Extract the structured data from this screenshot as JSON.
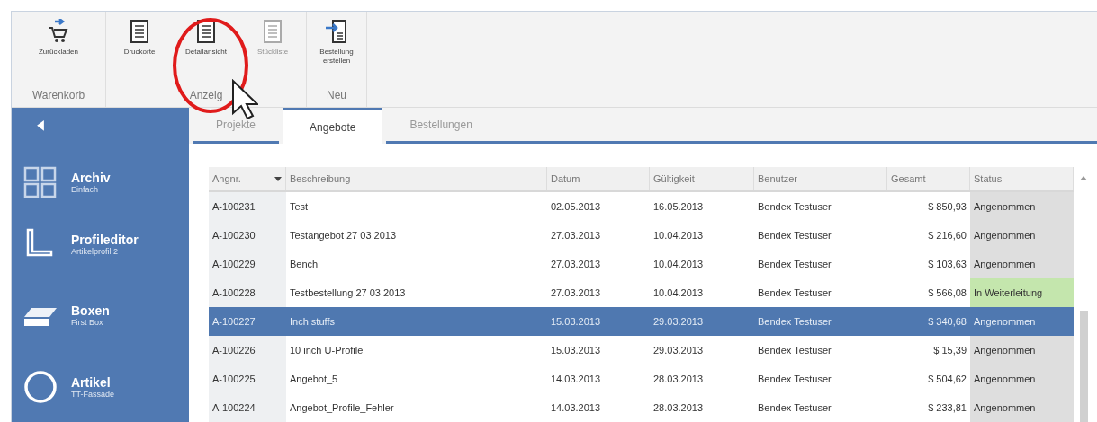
{
  "ribbon": {
    "groups": [
      {
        "label": "Warenkorb",
        "buttons": [
          {
            "label": "Zurückladen",
            "disabled": false
          }
        ]
      },
      {
        "label": "Anzeig",
        "buttons": [
          {
            "label": "Druckorte",
            "disabled": false
          },
          {
            "label": "Detailansicht",
            "disabled": false
          },
          {
            "label": "Stückliste",
            "disabled": true
          }
        ]
      },
      {
        "label": "Neu",
        "buttons": [
          {
            "label": "Bestellung erstellen",
            "disabled": false
          }
        ]
      }
    ]
  },
  "sidebar": {
    "items": [
      {
        "title": "Archiv",
        "subtitle": "Einfach"
      },
      {
        "title": "Profileditor",
        "subtitle": "Artikelprofil 2"
      },
      {
        "title": "Boxen",
        "subtitle": "First Box"
      },
      {
        "title": "Artikel",
        "subtitle": "TT-Fassade"
      }
    ]
  },
  "tabs": [
    {
      "label": "Projekte",
      "selected": false
    },
    {
      "label": "Angebote",
      "selected": true
    },
    {
      "label": "Bestellungen",
      "selected": false
    }
  ],
  "table": {
    "columns": [
      "Angnr.",
      "Beschreibung",
      "Datum",
      "Gültigkeit",
      "Benutzer",
      "Gesamt",
      "Status"
    ],
    "rows": [
      {
        "cells": [
          "A-100231",
          "Test",
          "02.05.2013",
          "16.05.2013",
          "Bendex Testuser",
          "$ 850,93",
          "Angenommen"
        ],
        "selected": false,
        "color": "#dedede"
      },
      {
        "cells": [
          "A-100230",
          "Testangebot 27 03 2013",
          "27.03.2013",
          "10.04.2013",
          "Bendex Testuser",
          "$ 216,60",
          "Angenommen"
        ],
        "selected": false,
        "color": "#dedede"
      },
      {
        "cells": [
          "A-100229",
          "Bench",
          "27.03.2013",
          "10.04.2013",
          "Bendex Testuser",
          "$ 103,63",
          "Angenommen"
        ],
        "selected": false,
        "color": "#dedede"
      },
      {
        "cells": [
          "A-100228",
          "Testbestellung 27 03 2013",
          "27.03.2013",
          "10.04.2013",
          "Bendex Testuser",
          "$ 566,08",
          "In Weiterleitung"
        ],
        "selected": false,
        "color": "#c4e6ad"
      },
      {
        "cells": [
          "A-100227",
          "Inch stuffs",
          "15.03.2013",
          "29.03.2013",
          "Bendex Testuser",
          "$ 340,68",
          "Angenommen"
        ],
        "selected": true
      },
      {
        "cells": [
          "A-100226",
          "10 inch U-Profile",
          "15.03.2013",
          "29.03.2013",
          "Bendex Testuser",
          "$ 15,39",
          "Angenommen"
        ],
        "selected": false,
        "color": "#dedede"
      },
      {
        "cells": [
          "A-100225",
          "Angebot_5",
          "14.03.2013",
          "28.03.2013",
          "Bendex Testuser",
          "$ 504,62",
          "Angenommen"
        ],
        "selected": false,
        "color": "#dedede"
      },
      {
        "cells": [
          "A-100224",
          "Angebot_Profile_Fehler",
          "14.03.2013",
          "28.03.2013",
          "Bendex Testuser",
          "$ 233,81",
          "Angenommen"
        ],
        "selected": false,
        "color": "#dedede"
      }
    ]
  }
}
